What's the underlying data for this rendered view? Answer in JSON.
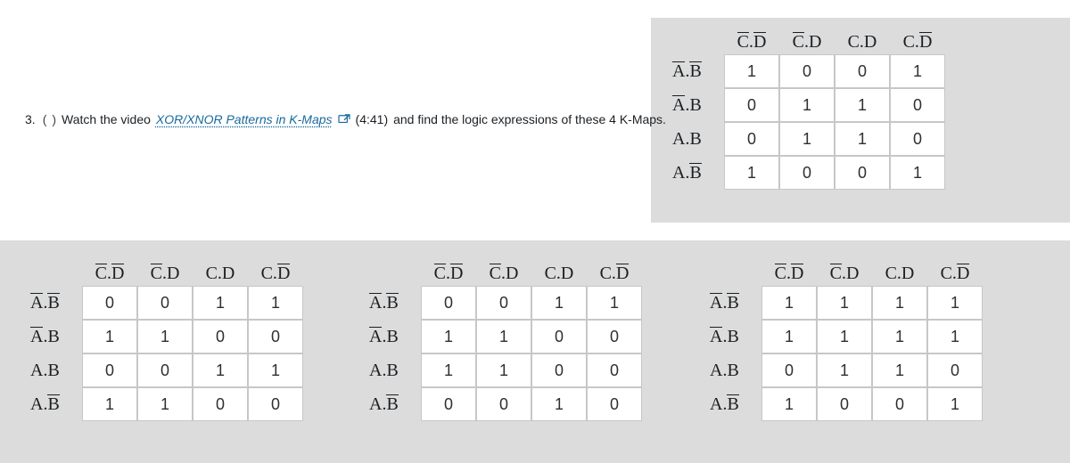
{
  "prompt": {
    "number": "3.",
    "paren_open": "(",
    "paren_close": ")",
    "lead": "Watch the video",
    "link_text": "XOR/XNOR Patterns in K-Maps",
    "duration": "(4:41)",
    "tail": "and find the logic expressions of these 4 K-Maps."
  },
  "labels": {
    "col_CbarDbar": "C̅.D̅",
    "col_CbarD": "C̅.D",
    "col_CD": "C.D",
    "col_CDbar": "C.D̅",
    "row_AbarBbar": "A̅.B̅",
    "row_AbarB": "A̅.B",
    "row_AB": "A.B",
    "row_ABbar": "A.B̅"
  },
  "kmaps": {
    "top": {
      "col_order": [
        "col_CbarDbar",
        "col_CbarD",
        "col_CD",
        "col_CDbar"
      ],
      "row_order": [
        "row_AbarBbar",
        "row_AbarB",
        "row_AB",
        "row_ABbar"
      ],
      "cells": [
        [
          "1",
          "0",
          "0",
          "1"
        ],
        [
          "0",
          "1",
          "1",
          "0"
        ],
        [
          "0",
          "1",
          "1",
          "0"
        ],
        [
          "1",
          "0",
          "0",
          "1"
        ]
      ]
    },
    "b1": {
      "col_order": [
        "col_CbarDbar",
        "col_CbarD",
        "col_CD",
        "col_CDbar"
      ],
      "row_order": [
        "row_AbarBbar",
        "row_AbarB",
        "row_AB",
        "row_ABbar"
      ],
      "cells": [
        [
          "0",
          "0",
          "1",
          "1"
        ],
        [
          "1",
          "1",
          "0",
          "0"
        ],
        [
          "0",
          "0",
          "1",
          "1"
        ],
        [
          "1",
          "1",
          "0",
          "0"
        ]
      ]
    },
    "b2": {
      "col_order": [
        "col_CbarDbar",
        "col_CbarD",
        "col_CD",
        "col_CDbar"
      ],
      "row_order": [
        "row_AbarBbar",
        "row_AbarB",
        "row_AB",
        "row_ABbar"
      ],
      "cells": [
        [
          "0",
          "0",
          "1",
          "1"
        ],
        [
          "1",
          "1",
          "0",
          "0"
        ],
        [
          "1",
          "1",
          "0",
          "0"
        ],
        [
          "0",
          "0",
          "1",
          "0"
        ]
      ]
    },
    "b3": {
      "col_order": [
        "col_CbarDbar",
        "col_CbarD",
        "col_CD",
        "col_CDbar"
      ],
      "row_order": [
        "row_AbarBbar",
        "row_AbarB",
        "row_AB",
        "row_ABbar"
      ],
      "cells": [
        [
          "1",
          "1",
          "1",
          "1"
        ],
        [
          "1",
          "1",
          "1",
          "1"
        ],
        [
          "0",
          "1",
          "1",
          "0"
        ],
        [
          "1",
          "0",
          "0",
          "1"
        ]
      ]
    }
  }
}
